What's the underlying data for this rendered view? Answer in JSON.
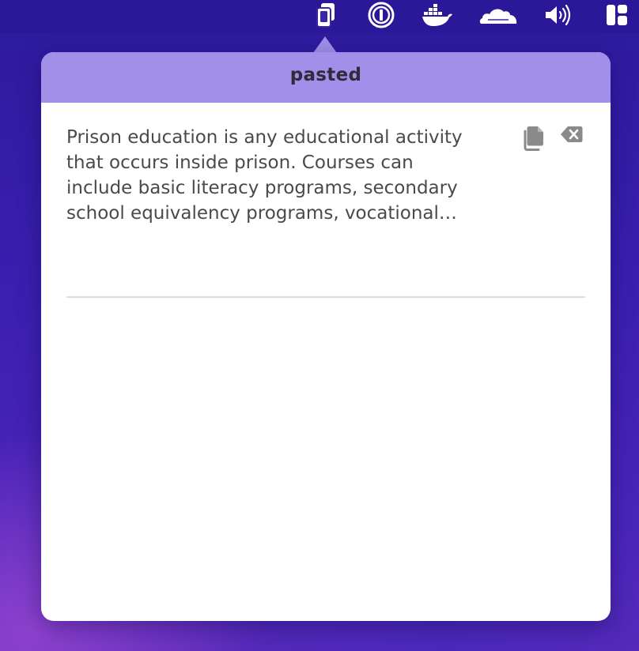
{
  "menubar": {
    "icons": [
      {
        "name": "clipboard-icon"
      },
      {
        "name": "1password-icon"
      },
      {
        "name": "docker-icon"
      },
      {
        "name": "cloudflare-icon"
      },
      {
        "name": "volume-icon"
      },
      {
        "name": "layout-grid-icon"
      }
    ]
  },
  "popover": {
    "title": "pasted",
    "accent_color": "#a18fea",
    "entries": [
      {
        "text": "Prison education is any educational activity\nthat occurs inside prison. Courses can\ninclude basic literacy programs, secondary\nschool equivalency programs, vocational…",
        "actions": [
          "copy-icon",
          "delete-icon"
        ]
      }
    ]
  }
}
